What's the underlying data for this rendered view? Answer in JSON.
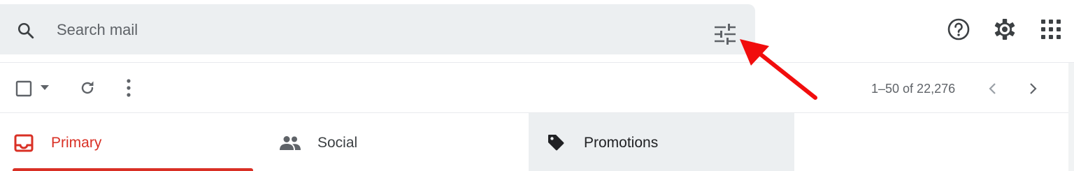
{
  "search": {
    "placeholder": "Search mail",
    "value": ""
  },
  "icons": {
    "search": "search-icon",
    "tune": "tune-icon",
    "help": "help-icon",
    "settings": "gear-icon",
    "apps": "apps-grid-icon",
    "checkbox": "checkbox-icon",
    "select_dropdown": "chevron-down-icon",
    "refresh": "refresh-icon",
    "more": "more-vertical-icon",
    "prev": "chevron-left-icon",
    "next": "chevron-right-icon",
    "primary_tab": "inbox-icon",
    "social_tab": "people-icon",
    "promotions_tab": "tag-icon"
  },
  "toolbar": {
    "pagination": "1–50 of 22,276"
  },
  "tabs": [
    {
      "label": "Primary",
      "active": true
    },
    {
      "label": "Social",
      "active": false
    },
    {
      "label": "Promotions",
      "active": false
    }
  ],
  "colors": {
    "search_bg": "#eceff1",
    "primary_accent": "#d93025",
    "icon_gray": "#5f6368",
    "annotation_arrow": "#f10d0d",
    "promotions_tab_bg": "#eceff1"
  }
}
